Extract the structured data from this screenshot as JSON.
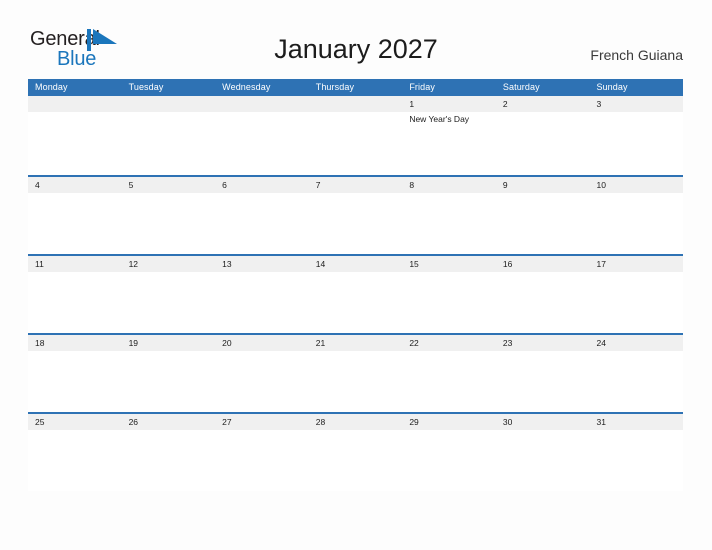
{
  "brand": {
    "name_part1": "General",
    "name_part2": "Blue",
    "flag_color": "#1b76bc"
  },
  "header": {
    "title": "January 2027",
    "location": "French Guiana"
  },
  "theme": {
    "accent_blue": "#2e72b4",
    "band_gray": "#f0f0f0",
    "page_background": "#fdfdfd",
    "brand_blue": "#1b76bc"
  },
  "calendar": {
    "month": "January",
    "year": "2027",
    "weekday_headers": [
      "Monday",
      "Tuesday",
      "Wednesday",
      "Thursday",
      "Friday",
      "Saturday",
      "Sunday"
    ],
    "weeks": [
      [
        {
          "date": "",
          "events": []
        },
        {
          "date": "",
          "events": []
        },
        {
          "date": "",
          "events": []
        },
        {
          "date": "",
          "events": []
        },
        {
          "date": "1",
          "events": [
            "New Year's Day"
          ]
        },
        {
          "date": "2",
          "events": []
        },
        {
          "date": "3",
          "events": []
        }
      ],
      [
        {
          "date": "4",
          "events": []
        },
        {
          "date": "5",
          "events": []
        },
        {
          "date": "6",
          "events": []
        },
        {
          "date": "7",
          "events": []
        },
        {
          "date": "8",
          "events": []
        },
        {
          "date": "9",
          "events": []
        },
        {
          "date": "10",
          "events": []
        }
      ],
      [
        {
          "date": "11",
          "events": []
        },
        {
          "date": "12",
          "events": []
        },
        {
          "date": "13",
          "events": []
        },
        {
          "date": "14",
          "events": []
        },
        {
          "date": "15",
          "events": []
        },
        {
          "date": "16",
          "events": []
        },
        {
          "date": "17",
          "events": []
        }
      ],
      [
        {
          "date": "18",
          "events": []
        },
        {
          "date": "19",
          "events": []
        },
        {
          "date": "20",
          "events": []
        },
        {
          "date": "21",
          "events": []
        },
        {
          "date": "22",
          "events": []
        },
        {
          "date": "23",
          "events": []
        },
        {
          "date": "24",
          "events": []
        }
      ],
      [
        {
          "date": "25",
          "events": []
        },
        {
          "date": "26",
          "events": []
        },
        {
          "date": "27",
          "events": []
        },
        {
          "date": "28",
          "events": []
        },
        {
          "date": "29",
          "events": []
        },
        {
          "date": "30",
          "events": []
        },
        {
          "date": "31",
          "events": []
        }
      ]
    ]
  }
}
